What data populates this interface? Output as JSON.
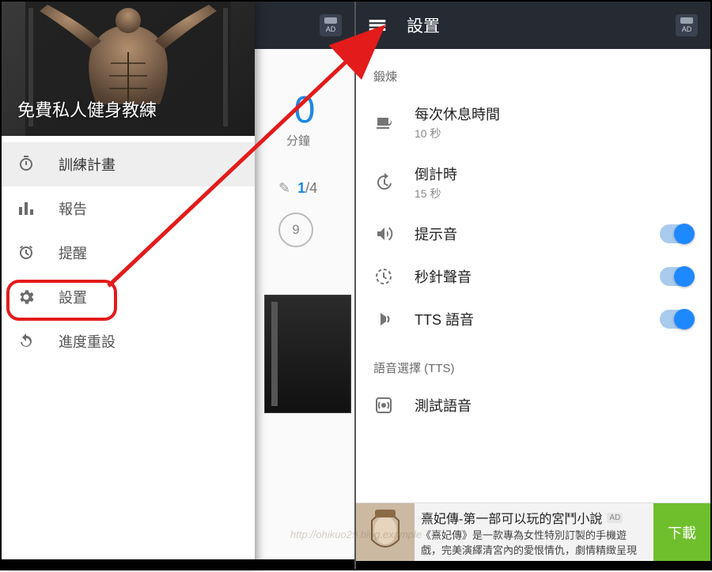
{
  "left": {
    "drawer_title": "免費私人健身教練",
    "items": [
      {
        "label": "訓練計畫"
      },
      {
        "label": "報告"
      },
      {
        "label": "提醒"
      },
      {
        "label": "設置"
      },
      {
        "label": "進度重設"
      }
    ],
    "bg": {
      "big_num": "0",
      "minutes_label": "分鐘",
      "ratio_num": "1",
      "ratio_total": "/4",
      "circle_value": "9"
    }
  },
  "right": {
    "title": "設置",
    "section_training": "鍛煉",
    "rows": {
      "rest": {
        "title": "每次休息時間",
        "sub": "10 秒"
      },
      "count": {
        "title": "倒計時",
        "sub": "15 秒"
      },
      "sound": {
        "title": "提示音"
      },
      "tick": {
        "title": "秒針聲音"
      },
      "tts": {
        "title": "TTS 語音"
      }
    },
    "section_tts": "語音選擇 (TTS)",
    "test_voice": "測試語音"
  },
  "ad": {
    "title": "熹妃傳-第一部可以玩的宮鬥小說",
    "line2": "《熹妃傳》是一款專為女性特別訂製的手機遊",
    "line3": "戲，完美演繹清宮內的愛恨情仇，劇情精緻呈現",
    "badge": "AD",
    "button": "下載"
  },
  "watermark": "http://ohikuo29.blog.example"
}
